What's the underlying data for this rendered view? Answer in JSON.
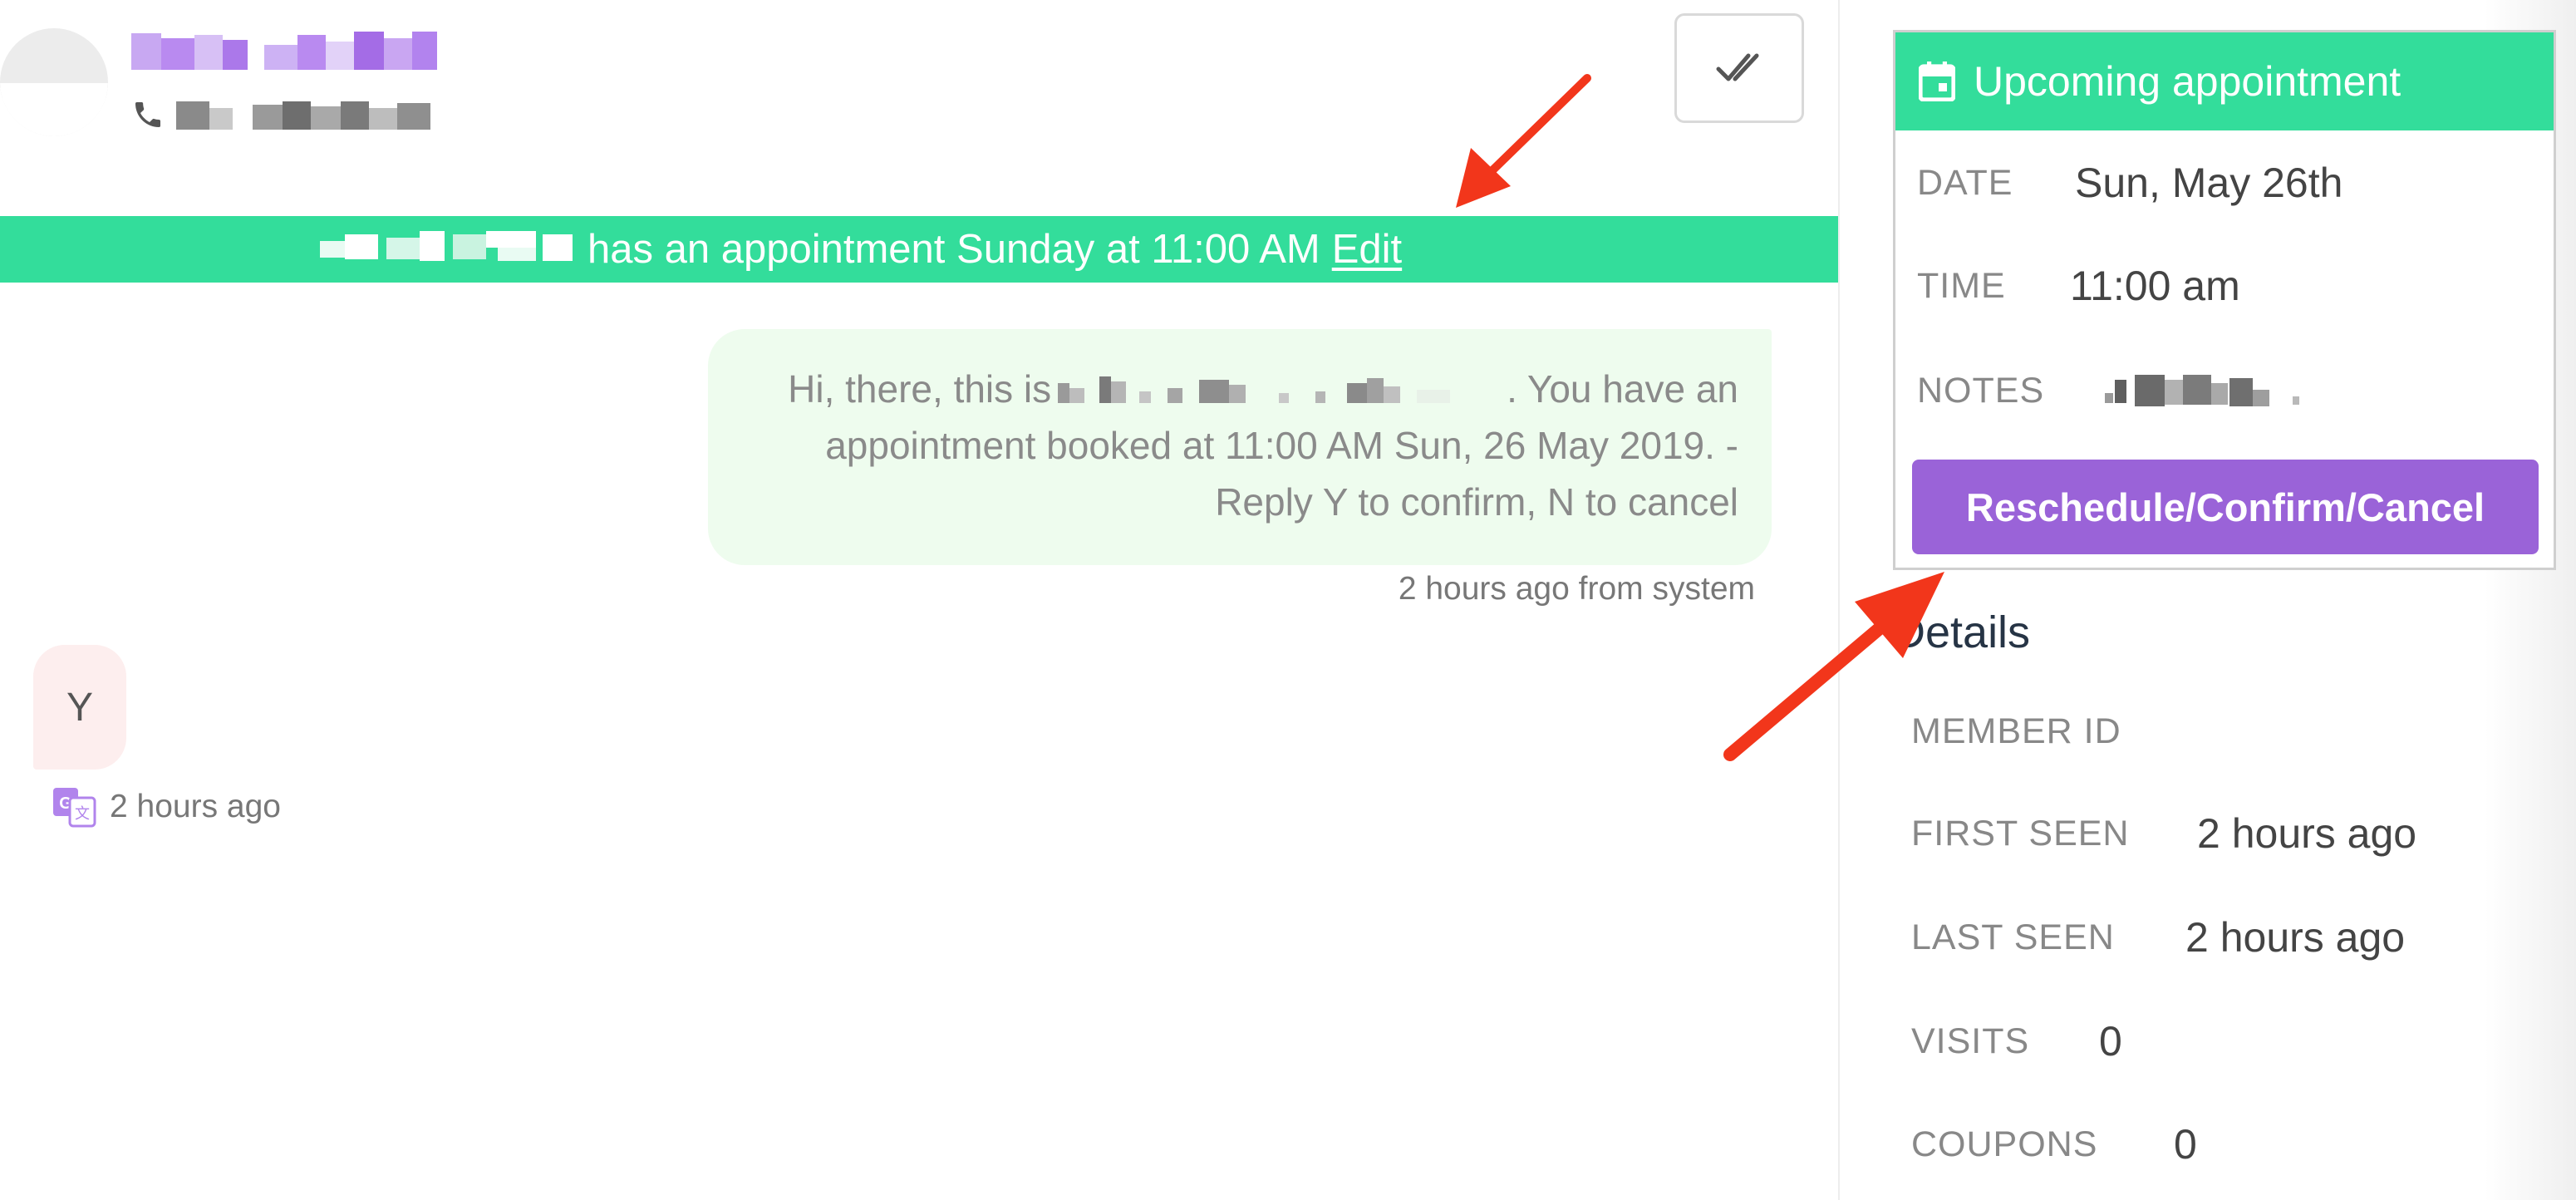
{
  "conversation": {
    "banner": {
      "text": "has an appointment Sunday at 11:00 AM",
      "edit_label": "Edit"
    },
    "outgoing_message": {
      "text_before": "Hi, there, this is",
      "text_after": ". You have an appointment booked at 11:00 AM Sun, 26 May 2019. - Reply Y to confirm, N to cancel",
      "meta": "2 hours ago from system"
    },
    "incoming_message": {
      "text": "Y",
      "meta": "2 hours ago"
    }
  },
  "sidebar": {
    "appointment": {
      "header": "Upcoming appointment",
      "date_label": "DATE",
      "date_value": "Sun, May 26th",
      "time_label": "TIME",
      "time_value": "11:00 am",
      "notes_label": "NOTES",
      "action_button": "Reschedule/Confirm/Cancel"
    },
    "details": {
      "title": "Details",
      "member_id_label": "MEMBER ID",
      "first_seen_label": "FIRST SEEN",
      "first_seen_value": "2 hours ago",
      "last_seen_label": "LAST SEEN",
      "last_seen_value": "2 hours ago",
      "visits_label": "VISITS",
      "visits_value": "0",
      "coupons_label": "COUPONS",
      "coupons_value": "0"
    }
  },
  "icons": {
    "check": "double-check-icon",
    "phone": "phone-icon",
    "calendar": "calendar-icon",
    "translate": "translate-icon",
    "avatar": "avatar-placeholder"
  },
  "colors": {
    "banner": "#33dd9b",
    "appointment_header": "#33dd9b",
    "primary_button": "#9a63d8",
    "contact_name": "#b98af0",
    "outgoing_bubble": "#eefcee",
    "incoming_bubble": "#fdeeee",
    "annotation_arrow": "#f2361b"
  }
}
